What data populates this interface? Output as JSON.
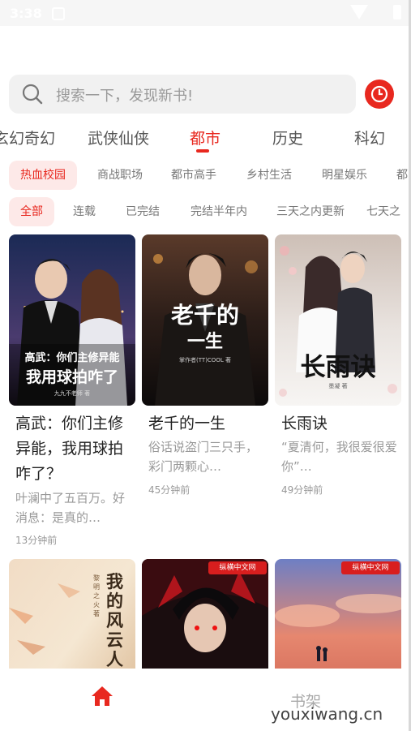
{
  "status_bar": {
    "time": "3:38"
  },
  "search": {
    "placeholder": "搜索一下，发现新书!"
  },
  "categories": [
    "玄幻奇幻",
    "武侠仙侠",
    "都市",
    "历史",
    "科幻"
  ],
  "subcategories": [
    "热血校园",
    "商战职场",
    "都市高手",
    "乡村生活",
    "明星娱乐",
    "都"
  ],
  "filters": [
    "全部",
    "连载",
    "已完结",
    "完结半年内",
    "三天之内更新",
    "七天之"
  ],
  "books": [
    {
      "cover_title_line1": "高武：你们主修异能",
      "cover_title_line2": "我用球拍咋了",
      "cover_author": "九九不老师 著",
      "title": "高武：你们主修异能，我用球拍咋了？",
      "desc": "叶澜中了五百万。好消息：是真的…",
      "time": "13分钟前"
    },
    {
      "cover_title_line1": "老千的",
      "cover_title_line2": "一生",
      "cover_author": "掌作者(TT)COOL 著",
      "title": "老千的一生",
      "desc": "俗话说盗门三只手，彩门两颗心…",
      "time": "45分钟前"
    },
    {
      "cover_title_line1": "长雨诀",
      "cover_author": "墨凝 著",
      "title": "长雨诀",
      "desc": "“夏清何，我很爱很爱你”…",
      "time": "49分钟前"
    },
    {
      "cover_title_line1": "我的风云人生",
      "cover_author": "黎明之火 著"
    },
    {
      "badge": "纵横中文网"
    },
    {
      "badge": "纵横中文网"
    }
  ],
  "bottom_nav": {
    "home": "home-icon",
    "shelf": "书架"
  },
  "watermark": "youxiwang.cn",
  "colors": {
    "accent": "#e8281f",
    "chip_bg": "#fde9e8"
  }
}
